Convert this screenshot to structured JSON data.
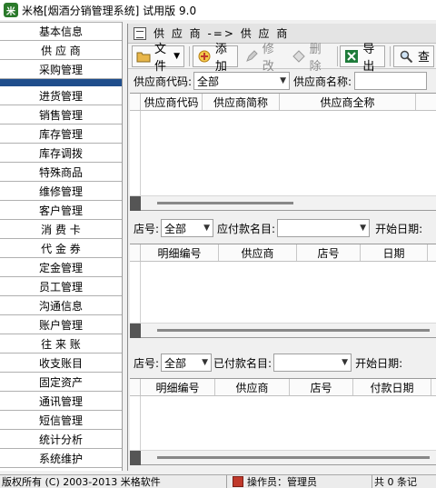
{
  "window": {
    "title": "米格[烟酒分销管理系统] 试用版 9.0"
  },
  "nav": {
    "items": [
      "基本信息",
      "供 应 商",
      "采购管理",
      "",
      "进货管理",
      "销售管理",
      "库存管理",
      "库存调拨",
      "特殊商品",
      "维修管理",
      "客户管理",
      "消 费 卡",
      "代 金 券",
      "定金管理",
      "员工管理",
      "沟通信息",
      "账户管理",
      "往 来 账",
      "收支账目",
      "固定资产",
      "通讯管理",
      "短信管理",
      "统计分析",
      "系统维护"
    ]
  },
  "crumb": {
    "text": "供 应 商 -=> 供 应 商"
  },
  "toolbar": {
    "file": "文件",
    "add": "添加",
    "edit": "修改",
    "delete": "删除",
    "export": "导出",
    "query": "查"
  },
  "supplier_filter": {
    "code_label": "供应商代码:",
    "code_value": "全部",
    "name_label": "供应商名称:"
  },
  "supplier_grid": {
    "columns": [
      "供应商代码",
      "供应商简称",
      "供应商全称"
    ]
  },
  "payable_filter": {
    "store_label": "店号:",
    "store_value": "全部",
    "item_label": "应付款名目:",
    "item_value": "",
    "start_label": "开始日期:"
  },
  "payable_grid": {
    "columns": [
      "明细编号",
      "供应商",
      "店号",
      "日期"
    ]
  },
  "paid_filter": {
    "store_label": "店号:",
    "store_value": "全部",
    "item_label": "已付款名目:",
    "item_value": "",
    "start_label": "开始日期:"
  },
  "paid_grid": {
    "columns": [
      "明细编号",
      "供应商",
      "店号",
      "付款日期"
    ]
  },
  "status": {
    "copyright": "版权所有 (C) 2003-2013 米格软件",
    "operator": "操作员：管理员",
    "tail": "共 0 条记"
  }
}
